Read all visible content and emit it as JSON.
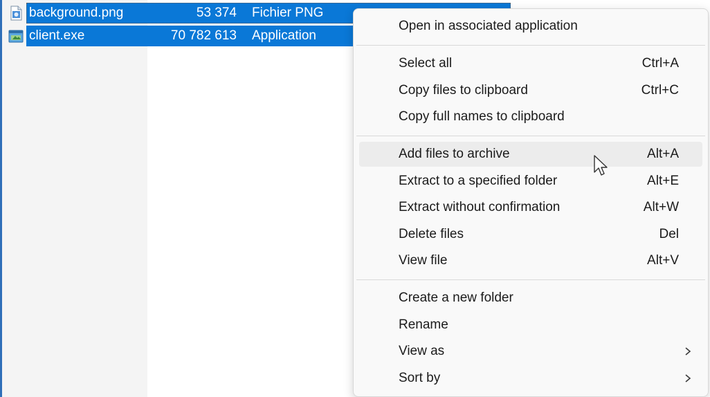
{
  "files": [
    {
      "name": "background.png",
      "size": "53 374",
      "type": "Fichier PNG",
      "date": "",
      "icon": "png-image-icon"
    },
    {
      "name": "client.exe",
      "size": "70 782 613",
      "type": "Application",
      "date": "",
      "icon": "application-icon"
    }
  ],
  "menu": {
    "open": {
      "label": "Open in associated application",
      "shortcut": ""
    },
    "select_all": {
      "label": "Select all",
      "shortcut": "Ctrl+A"
    },
    "copy_files": {
      "label": "Copy files to clipboard",
      "shortcut": "Ctrl+C"
    },
    "copy_names": {
      "label": "Copy full names to clipboard",
      "shortcut": ""
    },
    "add_archive": {
      "label": "Add files to archive",
      "shortcut": "Alt+A"
    },
    "extract_folder": {
      "label": "Extract to a specified folder",
      "shortcut": "Alt+E"
    },
    "extract_noconfirm": {
      "label": "Extract without confirmation",
      "shortcut": "Alt+W"
    },
    "delete": {
      "label": "Delete files",
      "shortcut": "Del"
    },
    "view_file": {
      "label": "View file",
      "shortcut": "Alt+V"
    },
    "new_folder": {
      "label": "Create a new folder",
      "shortcut": ""
    },
    "rename": {
      "label": "Rename",
      "shortcut": ""
    },
    "view_as": {
      "label": "View as",
      "submenu_icon": "chevron-right-icon"
    },
    "sort_by": {
      "label": "Sort by",
      "submenu_icon": "chevron-right-icon"
    }
  },
  "colors": {
    "selection": "#0a78d7",
    "menu_background": "#f9f9f9",
    "menu_hover": "#ececec"
  }
}
